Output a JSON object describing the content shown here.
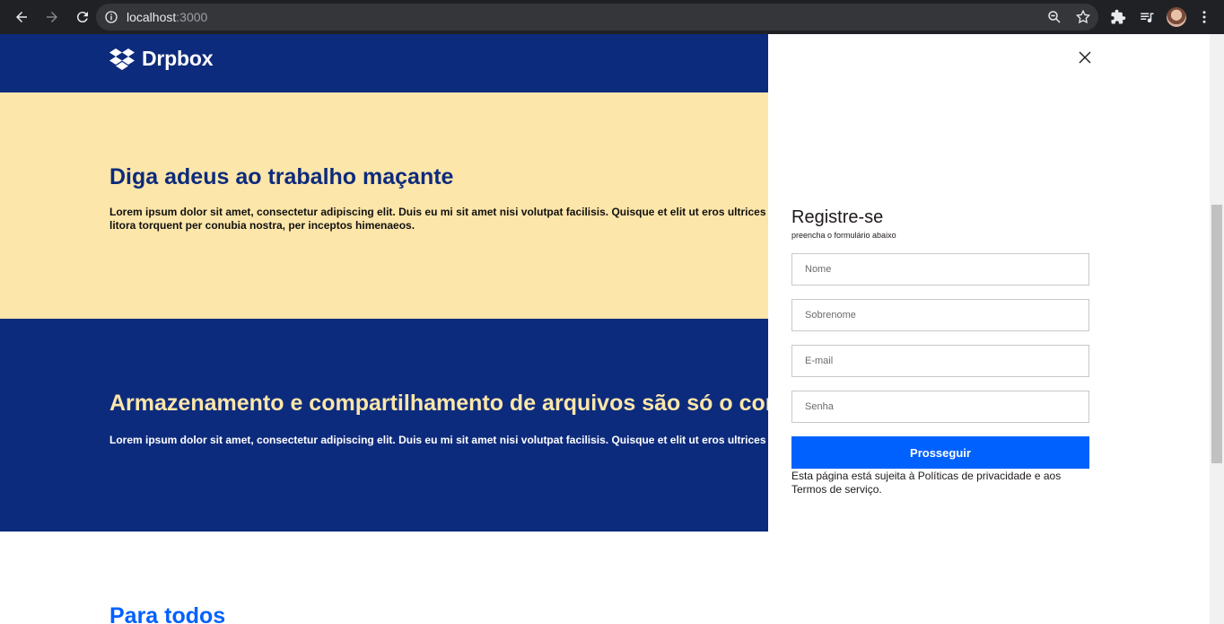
{
  "browser": {
    "url_host": "localhost",
    "url_port": ":3000"
  },
  "header": {
    "brand": "Drpbox"
  },
  "hero": {
    "title": "Diga adeus ao trabalho maçante",
    "text": "Lorem ipsum dolor sit amet, consectetur adipiscing elit. Duis eu mi sit amet nisi volutpat facilisis. Quisque et elit ut eros ultrices ad litora torquent per conubia nostra, per inceptos himenaeos."
  },
  "storage": {
    "title": "Armazenamento e compartilhamento de arquivos são só o come",
    "text": "Lorem ipsum dolor sit amet, consectetur adipiscing elit. Duis eu mi sit amet nisi volutpat facilisis. Quisque et elit ut eros ultrices r"
  },
  "section": {
    "title": "Para todos"
  },
  "register": {
    "title": "Registre-se",
    "subtitle": "preencha o formulário abaixo",
    "fields": {
      "first_name": "Nome",
      "last_name": "Sobrenome",
      "email": "E-mail",
      "password": "Senha"
    },
    "submit_label": "Prosseguir",
    "legal": "Esta página está sujeita à Políticas de privacidade e aos Termos de serviço."
  },
  "colors": {
    "navy": "#0d2b7d",
    "cream": "#fde6a9",
    "accent_blue": "#0061fe"
  }
}
